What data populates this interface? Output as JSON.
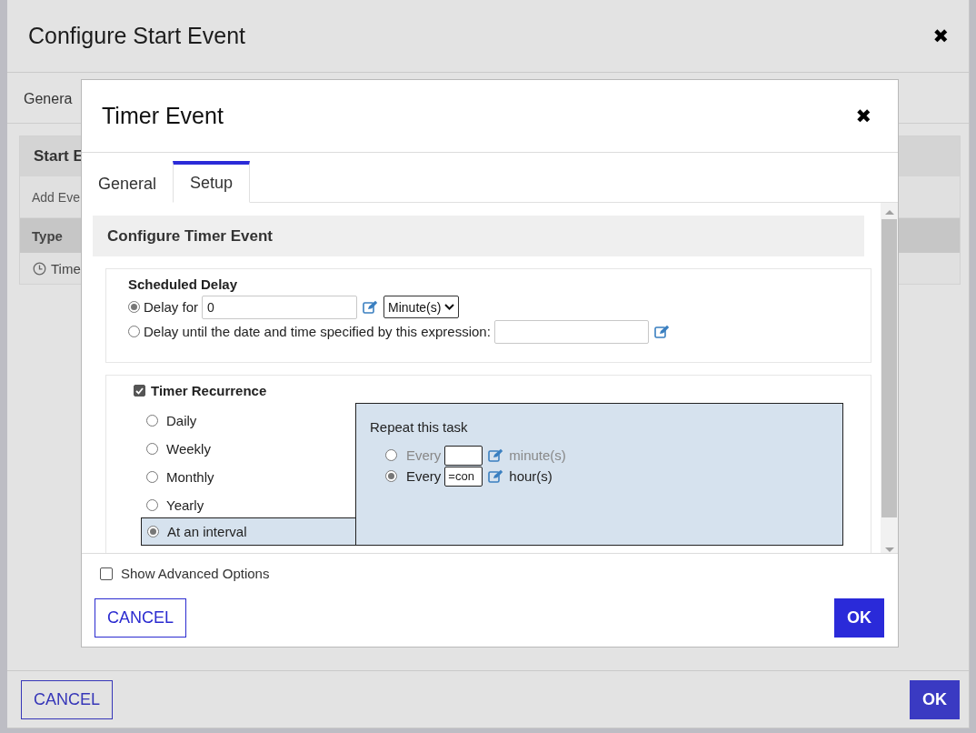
{
  "outer_dialog": {
    "title": "Configure Start Event",
    "close": "✖",
    "tab": "Genera",
    "panel": {
      "title": "Start E",
      "toolbar_link": "Add Eve",
      "column": "Type",
      "row": "Time"
    },
    "buttons": [
      {
        "kind": "secondary",
        "label": "CANCEL"
      },
      {
        "kind": "primary",
        "label": "OK"
      }
    ]
  },
  "timer_dialog": {
    "title": "Timer Event",
    "close": "✖",
    "tabs": [
      {
        "label": "General",
        "selected": false
      },
      {
        "label": "Setup",
        "selected": true
      }
    ],
    "section_title": "Configure Timer Event",
    "scheduled_delay": {
      "title": "Scheduled Delay",
      "options": [
        {
          "label": "Delay for",
          "selected": true,
          "value": "0",
          "unit": "Minute(s)"
        },
        {
          "label": "Delay until the date and time specified by this expression:",
          "selected": false
        }
      ]
    },
    "recurrence": {
      "label": "Timer Recurrence",
      "checked": true,
      "options": [
        {
          "label": "Daily",
          "selected": false
        },
        {
          "label": "Weekly",
          "selected": false
        },
        {
          "label": "Monthly",
          "selected": false
        },
        {
          "label": "Yearly",
          "selected": false
        },
        {
          "label": "At an interval",
          "selected": true
        }
      ],
      "interval_panel": {
        "title": "Repeat this task",
        "options": [
          {
            "label": "Every",
            "selected": false,
            "unit": "minute(s)"
          },
          {
            "label": "Every",
            "selected": true,
            "value": "=con",
            "unit": "hour(s)"
          }
        ]
      }
    },
    "show_advanced": {
      "label": "Show Advanced Options",
      "checked": false
    },
    "buttons": [
      {
        "kind": "secondary",
        "label": "CANCEL"
      },
      {
        "kind": "primary",
        "label": "OK"
      }
    ]
  }
}
